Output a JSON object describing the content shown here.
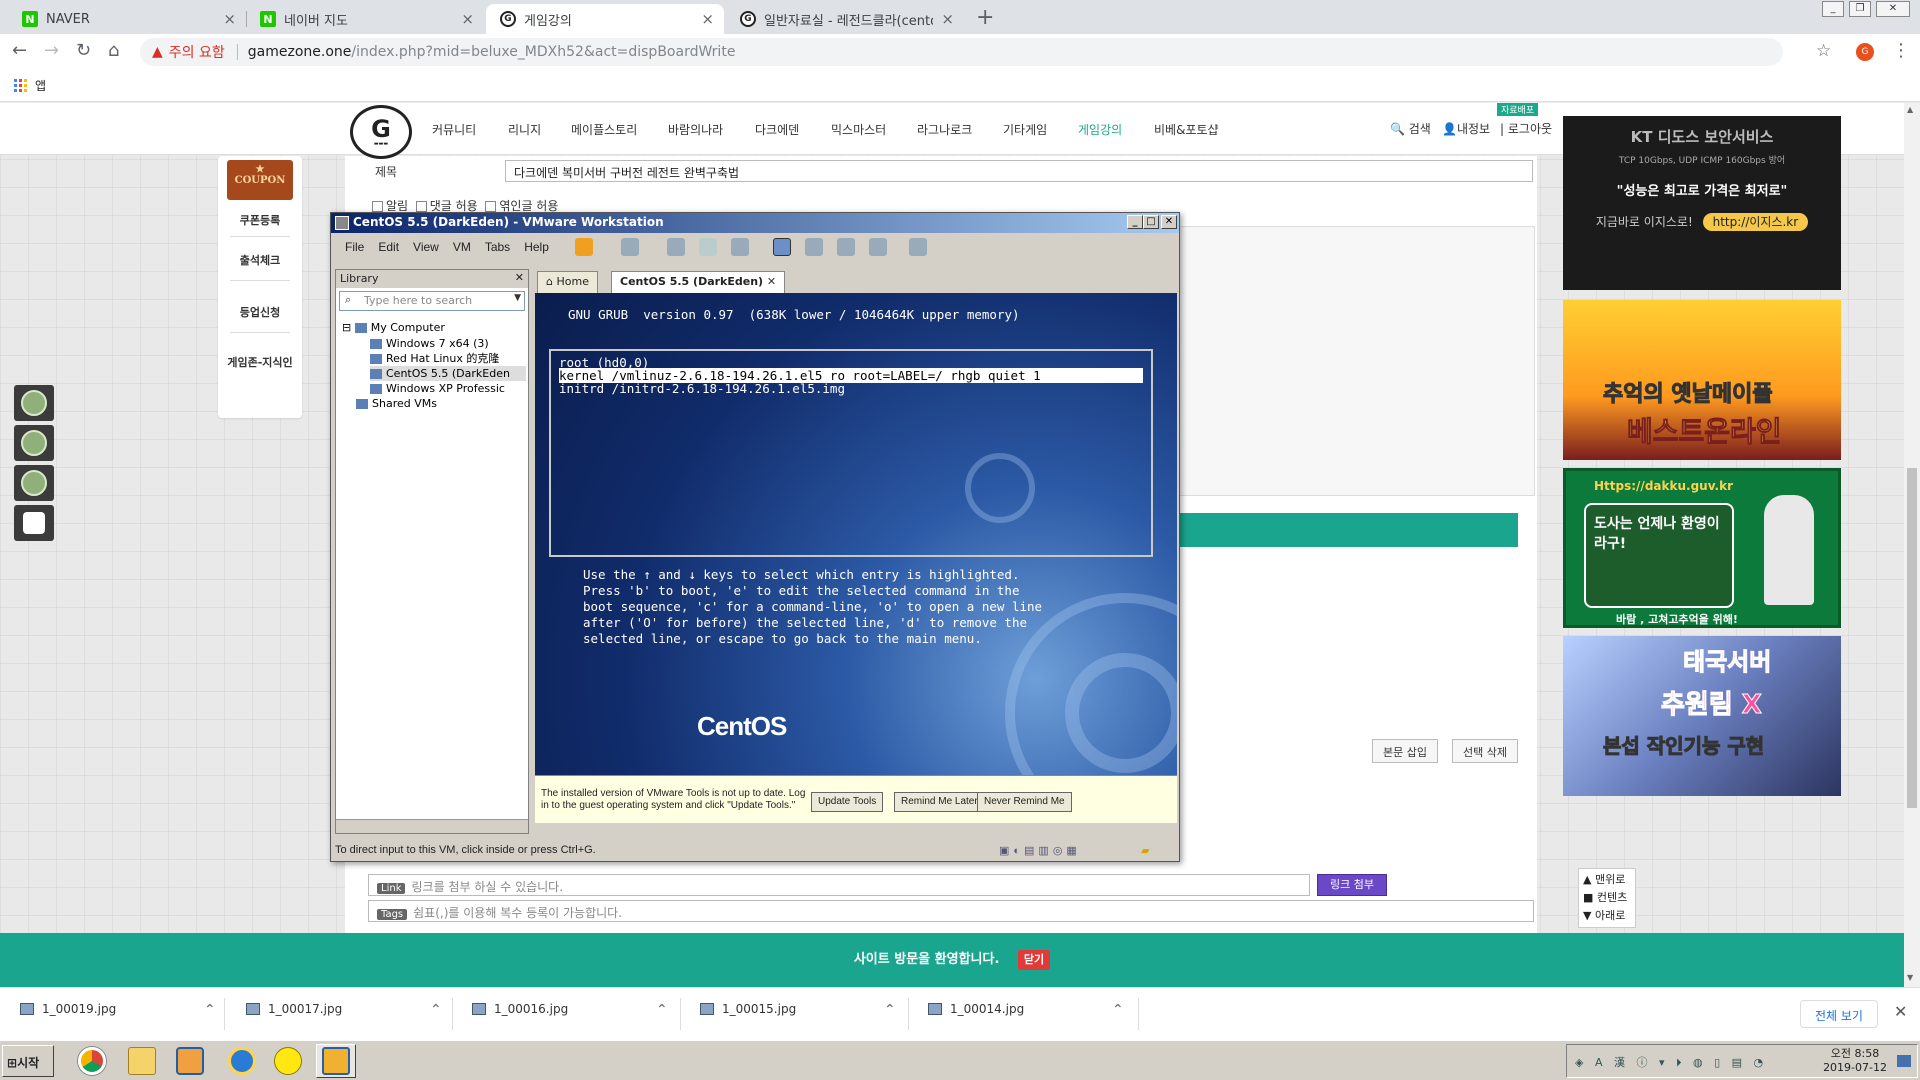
{
  "browser": {
    "tabs": [
      {
        "label": "NAVER",
        "favicon": "naver-icon"
      },
      {
        "label": "네이버 지도",
        "favicon": "naver-icon"
      },
      {
        "label": "게임강의",
        "favicon": "gamezone-icon"
      },
      {
        "label": "일반자료실 - 레전드클라(cento",
        "favicon": "gamezone-icon"
      }
    ],
    "security_warning": "주의 요함",
    "url_host": "gamezone.one",
    "url_path": "/index.php?mid=beluxe_MDXh52&act=dispBoardWrite",
    "bookmark_apps": "앱"
  },
  "site": {
    "menu": [
      "커뮤니티",
      "리니지",
      "메이플스토리",
      "바람의나라",
      "다크에덴",
      "믹스마스터",
      "라그나로크",
      "기타게임",
      "게임강의",
      "비베&포토샵"
    ],
    "active_menu": "게임강의",
    "new_badge": "자료배포",
    "util": {
      "search": "검색",
      "myinfo": "내정보",
      "logout": "로그아웃"
    },
    "left_menu": {
      "coupon": "COUPON",
      "items": [
        "쿠폰등록",
        "출석체크",
        "등업신청",
        "게임존-지식인"
      ]
    },
    "form": {
      "title_label": "제목",
      "title_value": "다크에덴 복미서버 구버전 레전트 완벽구축법",
      "options": [
        "알림",
        "댓글 허용",
        "엮인글 허용"
      ],
      "insert_btn": "본문 삽입",
      "delete_btn": "선택 삭제",
      "link_tag": "Link",
      "link_placeholder": "링크를 첨부 하실 수 있습니다.",
      "link_btn": "링크 첨부",
      "tags_tag": "Tags",
      "tags_placeholder": "쉼표(,)를 이용해 복수 등록이 가능합니다."
    },
    "ads": {
      "ad1_l1": "KT 디도스 보안서비스",
      "ad1_l2": "TCP 10Gbps, UDP ICMP 160Gbps 방어",
      "ad1_l3": "\"성능은 최고로 가격은 최저로\"",
      "ad1_l4": "지금바로 이지스로!",
      "ad1_url": "http://이지스.kr",
      "ad2_l1": "추억의 옛날메이플",
      "ad2_l2": "베스트온라인",
      "ad3_url": "Https://dakku.guv.kr",
      "ad3_l1": "도사는 언제나 환영이라구!",
      "ad3_l2": "바람 , 고쳐고추억을 위해!",
      "ad4_l1": "태국서버",
      "ad4_l2": "추원림 X",
      "ad4_l3": "본섭 작인기능 구현"
    },
    "quicknav": [
      "맨위로",
      "컨텐츠",
      "아래로"
    ],
    "welcome": "사이트 방문을 환영합니다.",
    "welcome_close": "닫기"
  },
  "vmware": {
    "title": "CentOS 5.5 (DarkEden) - VMware Workstation",
    "menus": [
      "File",
      "Edit",
      "View",
      "VM",
      "Tabs",
      "Help"
    ],
    "library_title": "Library",
    "library_search": "Type here to search",
    "tree": {
      "root": "My Computer",
      "vms": [
        "Windows 7 x64 (3)",
        "Red Hat Linux 的克隆",
        "CentOS 5.5 (DarkEden",
        "Windows XP Professic"
      ],
      "shared": "Shared VMs"
    },
    "tabs": [
      "Home",
      "CentOS 5.5 (DarkEden)"
    ],
    "grub": {
      "header": "GNU GRUB  version 0.97  (638K lower / 1046464K upper memory)",
      "lines": [
        "root (hd0,0)",
        "kernel /vmlinuz-2.6.18-194.26.1.el5 ro root=LABEL=/ rhgb quiet 1",
        "initrd /initrd-2.6.18-194.26.1.el5.img"
      ],
      "selected": 1,
      "help": "Use the ↑ and ↓ keys to select which entry is highlighted.\nPress 'b' to boot, 'e' to edit the selected command in the\nboot sequence, 'c' for a command-line, 'o' to open a new line\nafter ('O' for before) the selected line, 'd' to remove the\nselected line, or escape to go back to the main menu."
    },
    "logo": "CentOS",
    "notify": {
      "message": "The installed version of VMware Tools is not up to date. Log in to the guest operating system and click \"Update Tools.\"",
      "update": "Update Tools",
      "remind": "Remind Me Later",
      "never": "Never Remind Me"
    },
    "status": "To direct input to this VM, click inside or press Ctrl+G."
  },
  "downloads": {
    "files": [
      "1_00019.jpg",
      "1_00017.jpg",
      "1_00016.jpg",
      "1_00015.jpg",
      "1_00014.jpg"
    ],
    "show_all": "전체 보기"
  },
  "taskbar": {
    "start": "시작",
    "clock_time": "오전 8:58",
    "clock_date": "2019-07-12"
  }
}
